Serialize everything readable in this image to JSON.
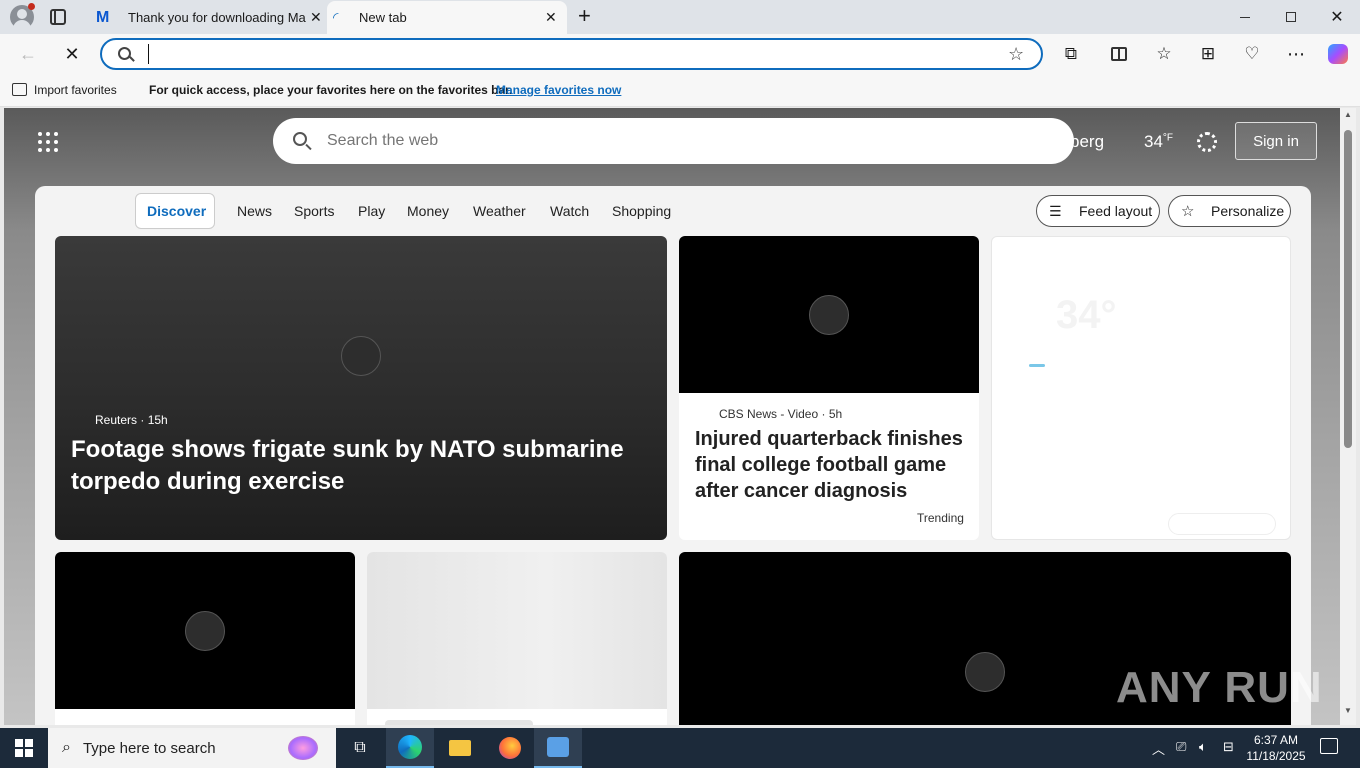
{
  "tabs": [
    {
      "title": "Thank you for downloading Malw"
    },
    {
      "title": "New tab"
    }
  ],
  "toolbar": {
    "address_value": ""
  },
  "favorites_bar": {
    "import_label": "Import favorites",
    "hint": "For quick access, place your favorites here on the favorites bar.",
    "manage_link": "Manage favorites now"
  },
  "newtab": {
    "search_placeholder": "Search the web",
    "location_partial": "berg",
    "temperature": "34",
    "temp_unit": "°F",
    "sign_in": "Sign in",
    "nav": [
      "Discover",
      "News",
      "Sports",
      "Play",
      "Money",
      "Weather",
      "Watch",
      "Shopping"
    ],
    "feed_layout": "Feed layout",
    "personalize": "Personalize"
  },
  "cards": {
    "hero": {
      "source": "Reuters",
      "age": "15h",
      "headline": "Footage shows frigate sunk by NATO submarine torpedo during exercise"
    },
    "story2": {
      "source": "CBS News - Video",
      "age": "5h",
      "headline": "Injured quarterback finishes final college football game after cancer diagnosis",
      "tag": "Trending"
    },
    "weather_widget": {
      "temp": "34°"
    }
  },
  "watermark": "ANY RUN",
  "taskbar": {
    "search_placeholder": "Type here to search",
    "time": "6:37 AM",
    "date": "11/18/2025"
  },
  "colors": {
    "accent": "#0f6cbd",
    "taskbar": "#1c2a3a"
  }
}
